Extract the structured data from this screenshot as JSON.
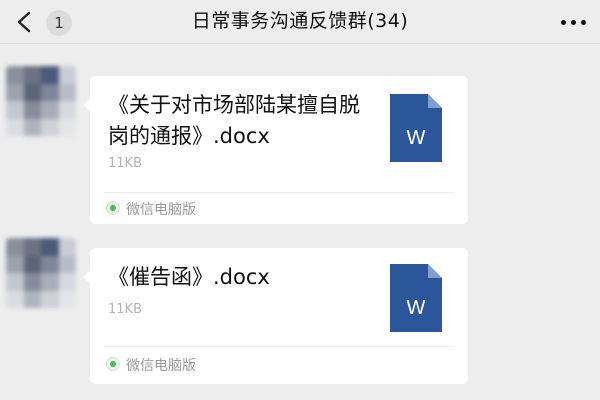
{
  "header": {
    "back_icon": "chevron-left-icon",
    "unread_count": "1",
    "title": "日常事务沟通反馈群(34)",
    "more_icon": "more-dots-icon"
  },
  "messages": [
    {
      "file_name": "《关于对市场部陆某擅自脱岗的通报》.docx",
      "file_size": "11KB",
      "file_icon": "word-document-icon",
      "file_icon_letter": "W",
      "source": "微信电脑版"
    },
    {
      "file_name": "《催告函》.docx",
      "file_size": "11KB",
      "file_icon": "word-document-icon",
      "file_icon_letter": "W",
      "source": "微信电脑版"
    }
  ],
  "colors": {
    "background": "#ededed",
    "bubble": "#ffffff",
    "word_blue": "#2b579a",
    "source_green": "#55b35a"
  }
}
